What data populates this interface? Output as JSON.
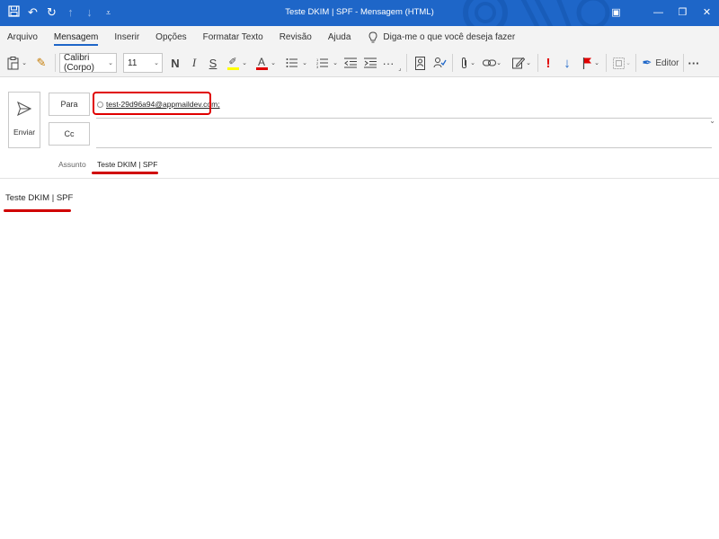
{
  "window": {
    "title": "Teste DKIM | SPF  -  Mensagem (HTML)",
    "controls": [
      "ribbon-display-icon",
      "minimize-icon",
      "restore-icon",
      "close-icon"
    ]
  },
  "quick_access": [
    "save-icon",
    "undo-icon",
    "redo-icon",
    "up-arrow-icon",
    "down-arrow-icon",
    "customize-icon"
  ],
  "menu": {
    "tabs": [
      "Arquivo",
      "Mensagem",
      "Inserir",
      "Opções",
      "Formatar Texto",
      "Revisão",
      "Ajuda"
    ],
    "active": "Mensagem",
    "tell_me": "Diga-me o que você deseja fazer"
  },
  "ribbon": {
    "font_name": "Calibri (Corpo)",
    "font_size": "11",
    "bold": "N",
    "italic": "I",
    "underline": "S",
    "font_color_letter": "A",
    "editor_label": "Editor",
    "more": "···"
  },
  "compose": {
    "send_label": "Enviar",
    "to_label": "Para",
    "cc_label": "Cc",
    "to_value": "test-29d96a94@appmaildev.com;",
    "subject_label": "Assunto",
    "subject_value": "Teste DKIM | SPF",
    "body_text": "Teste DKIM | SPF"
  },
  "colors": {
    "titlebar": "#1e66c8",
    "annotation_red": "#e00000",
    "highlight_yellow": "#ffff00",
    "font_color_red": "#e00000"
  }
}
